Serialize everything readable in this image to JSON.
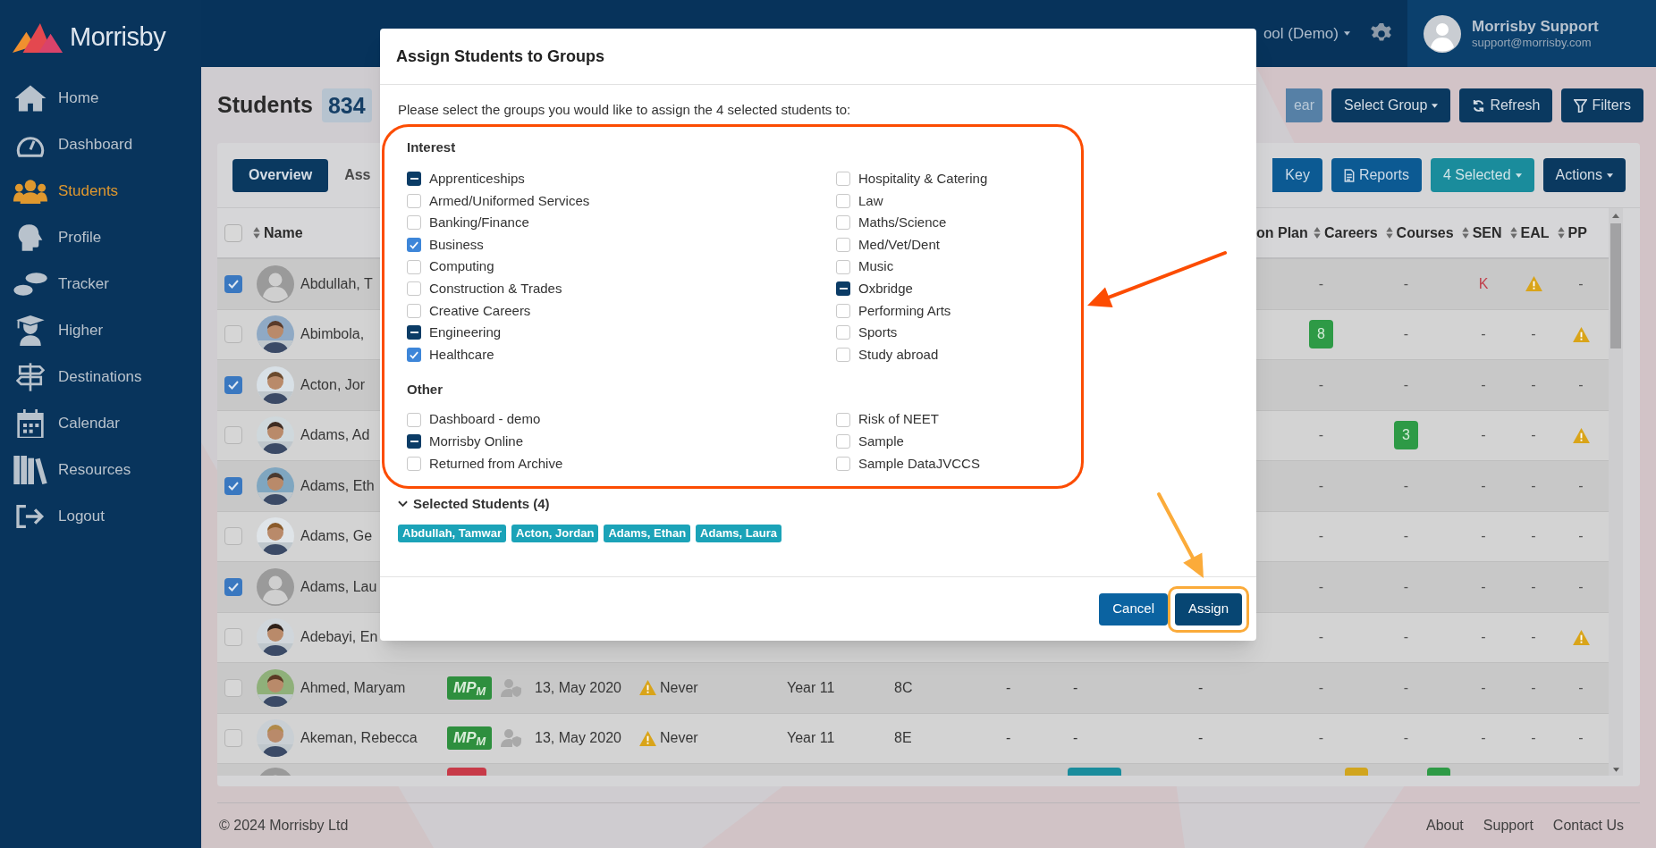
{
  "sidebar": {
    "logo": "Morrisby",
    "items": [
      {
        "label": "Home",
        "selected": false
      },
      {
        "label": "Dashboard",
        "selected": false
      },
      {
        "label": "Students",
        "selected": true
      },
      {
        "label": "Profile",
        "selected": false
      },
      {
        "label": "Tracker",
        "selected": false
      },
      {
        "label": "Higher",
        "selected": false
      },
      {
        "label": "Destinations",
        "selected": false
      },
      {
        "label": "Calendar",
        "selected": false
      },
      {
        "label": "Resources",
        "selected": false
      },
      {
        "label": "Logout",
        "selected": false
      }
    ]
  },
  "topbar": {
    "school": "ool (Demo)",
    "user": {
      "name": "Morrisby Support",
      "email": "support@morrisby.com"
    }
  },
  "page": {
    "title": "Students",
    "count": "834",
    "toolbar": [
      {
        "label": "ear",
        "disabled": true,
        "dropdown": false
      },
      {
        "label": "Select Group",
        "disabled": false,
        "dropdown": true
      },
      {
        "label": "Refresh",
        "disabled": false,
        "dropdown": false
      },
      {
        "label": "Filters",
        "disabled": false,
        "dropdown": false
      }
    ]
  },
  "tabs": [
    {
      "label": "Overview",
      "selected": true
    },
    {
      "label": "Ass",
      "selected": false
    }
  ],
  "table_actions": [
    {
      "label": "Key",
      "kind": "secondary",
      "dropdown": false
    },
    {
      "label": "Reports",
      "kind": "secondary",
      "dropdown": false
    },
    {
      "label": "4 Selected",
      "kind": "selection",
      "dropdown": true
    },
    {
      "label": "Actions",
      "kind": "primary",
      "dropdown": true
    }
  ],
  "table": {
    "select_all": {
      "checked": false
    },
    "columns": [
      {
        "label": "Name"
      },
      {
        "label": "on Plan"
      },
      {
        "label": "Careers"
      },
      {
        "label": "Courses"
      },
      {
        "label": "SEN"
      },
      {
        "label": "EAL"
      },
      {
        "label": "PP"
      }
    ],
    "rows": [
      {
        "kind": "student",
        "name": "Abdullah, T",
        "selected": true,
        "photo": false,
        "cells": [
          {
            "kind": "dash",
            "text": "-"
          },
          {
            "kind": "dash",
            "text": "-"
          },
          {
            "kind": "flag",
            "text": "K"
          },
          {
            "kind": "warning"
          },
          {
            "kind": "dash",
            "text": "-"
          }
        ]
      },
      {
        "kind": "student",
        "name": "Abimbola,",
        "selected": false,
        "photo": true,
        "cells": [
          {
            "kind": "count",
            "text": "8"
          },
          {
            "kind": "dash",
            "text": "-"
          },
          {
            "kind": "dash",
            "text": "-"
          },
          {
            "kind": "dash",
            "text": "-"
          },
          {
            "kind": "warning"
          }
        ]
      },
      {
        "kind": "student",
        "name": "Acton, Jor",
        "selected": true,
        "photo": true,
        "cells": [
          {
            "kind": "dash",
            "text": "-"
          },
          {
            "kind": "dash",
            "text": "-"
          },
          {
            "kind": "dash",
            "text": "-"
          },
          {
            "kind": "dash",
            "text": "-"
          },
          {
            "kind": "dash",
            "text": "-"
          }
        ]
      },
      {
        "kind": "student",
        "name": "Adams, Ad",
        "selected": false,
        "photo": true,
        "cells": [
          {
            "kind": "dash",
            "text": "-"
          },
          {
            "kind": "count",
            "text": "3"
          },
          {
            "kind": "dash",
            "text": "-"
          },
          {
            "kind": "dash",
            "text": "-"
          },
          {
            "kind": "warning"
          }
        ]
      },
      {
        "kind": "student",
        "name": "Adams, Eth",
        "selected": true,
        "photo": true,
        "cells": [
          {
            "kind": "dash",
            "text": "-"
          },
          {
            "kind": "dash",
            "text": "-"
          },
          {
            "kind": "dash",
            "text": "-"
          },
          {
            "kind": "dash",
            "text": "-"
          },
          {
            "kind": "dash",
            "text": "-"
          }
        ]
      },
      {
        "kind": "student",
        "name": "Adams, Ge",
        "selected": false,
        "photo": true,
        "cells": [
          {
            "kind": "dash",
            "text": "-"
          },
          {
            "kind": "dash",
            "text": "-"
          },
          {
            "kind": "dash",
            "text": "-"
          },
          {
            "kind": "dash",
            "text": "-"
          },
          {
            "kind": "dash",
            "text": "-"
          }
        ]
      },
      {
        "kind": "student",
        "name": "Adams, Lau",
        "selected": true,
        "photo": false,
        "cells": [
          {
            "kind": "dash",
            "text": "-"
          },
          {
            "kind": "dash",
            "text": "-"
          },
          {
            "kind": "dash",
            "text": "-"
          },
          {
            "kind": "dash",
            "text": "-"
          },
          {
            "kind": "dash",
            "text": "-"
          }
        ]
      },
      {
        "kind": "student",
        "name": "Adebayi, En",
        "selected": false,
        "photo": true,
        "cells": [
          {
            "kind": "dash",
            "text": "-"
          },
          {
            "kind": "dash",
            "text": "-"
          },
          {
            "kind": "dash",
            "text": "-"
          },
          {
            "kind": "dash",
            "text": "-"
          },
          {
            "kind": "warning"
          }
        ]
      },
      {
        "kind": "student",
        "name": "Ahmed, Maryam",
        "selected": false,
        "photo": true,
        "details": {
          "badge": "MP$_{M}$",
          "date": "13, May 2020",
          "login": "Never",
          "year": "Year 11",
          "form": "8C",
          "extra": [
            "-",
            "-",
            "-"
          ]
        },
        "cells": [
          {
            "kind": "dash",
            "text": "-"
          },
          {
            "kind": "dash",
            "text": "-"
          },
          {
            "kind": "dash",
            "text": "-"
          },
          {
            "kind": "dash",
            "text": "-"
          },
          {
            "kind": "dash",
            "text": "-"
          }
        ]
      },
      {
        "kind": "student",
        "name": "Akeman, Rebecca",
        "selected": false,
        "photo": true,
        "details": {
          "badge": "MP$_{M}$",
          "date": "13, May 2020",
          "login": "Never",
          "year": "Year 11",
          "form": "8E",
          "extra": [
            "-",
            "-",
            "-"
          ]
        },
        "cells": [
          {
            "kind": "dash",
            "text": "-"
          },
          {
            "kind": "dash",
            "text": "-"
          },
          {
            "kind": "dash",
            "text": "-"
          },
          {
            "kind": "dash",
            "text": "-"
          },
          {
            "kind": "dash",
            "text": "-"
          }
        ]
      },
      {
        "kind": "cut"
      }
    ]
  },
  "footer": {
    "copyright": "© 2024 Morrisby Ltd",
    "links": [
      "About",
      "Support",
      "Contact Us"
    ]
  },
  "modal": {
    "title": "Assign Students to Groups",
    "prompt": "Please select the groups you would like to assign the 4 selected students to:",
    "highlight": {
      "color": "#fc4c02"
    },
    "groups": [
      {
        "heading": "Interest",
        "items": [
          {
            "label": "Apprenticeships",
            "checked": false,
            "indeterminate": true
          },
          {
            "label": "Armed/Uniformed Services",
            "checked": false,
            "indeterminate": false
          },
          {
            "label": "Banking/Finance",
            "checked": false,
            "indeterminate": false
          },
          {
            "label": "Business",
            "checked": true,
            "indeterminate": false
          },
          {
            "label": "Computing",
            "checked": false,
            "indeterminate": false
          },
          {
            "label": "Construction & Trades",
            "checked": false,
            "indeterminate": false
          },
          {
            "label": "Creative Careers",
            "checked": false,
            "indeterminate": false
          },
          {
            "label": "Engineering",
            "checked": false,
            "indeterminate": true
          },
          {
            "label": "Healthcare",
            "checked": true,
            "indeterminate": false
          },
          {
            "label": "Hospitality & Catering",
            "checked": false,
            "indeterminate": false
          },
          {
            "label": "Law",
            "checked": false,
            "indeterminate": false
          },
          {
            "label": "Maths/Science",
            "checked": false,
            "indeterminate": false
          },
          {
            "label": "Med/Vet/Dent",
            "checked": false,
            "indeterminate": false
          },
          {
            "label": "Music",
            "checked": false,
            "indeterminate": false
          },
          {
            "label": "Oxbridge",
            "checked": false,
            "indeterminate": true
          },
          {
            "label": "Performing Arts",
            "checked": false,
            "indeterminate": false
          },
          {
            "label": "Sports",
            "checked": false,
            "indeterminate": false
          },
          {
            "label": "Study abroad",
            "checked": false,
            "indeterminate": false
          }
        ]
      },
      {
        "heading": "Other",
        "items": [
          {
            "label": "Dashboard - demo",
            "checked": false,
            "indeterminate": false
          },
          {
            "label": "Morrisby Online",
            "checked": false,
            "indeterminate": true
          },
          {
            "label": "Returned from Archive",
            "checked": false,
            "indeterminate": false
          },
          {
            "label": "Risk of NEET",
            "checked": false,
            "indeterminate": false
          },
          {
            "label": "Sample",
            "checked": false,
            "indeterminate": false
          },
          {
            "label": "Sample DataJVCCS",
            "checked": false,
            "indeterminate": false
          }
        ]
      }
    ],
    "selected_students": {
      "label": "Selected Students (4)",
      "expanded": true,
      "tags": [
        "Abdullah, Tamwar",
        "Acton, Jordan",
        "Adams, Ethan",
        "Adams, Laura"
      ]
    },
    "buttons": [
      {
        "label": "Cancel",
        "kind": "secondary"
      },
      {
        "label": "Assign",
        "kind": "primary",
        "highlight": {
          "color": "#fbab3a"
        }
      }
    ]
  },
  "arrows": [
    {
      "color": "#fc4c02"
    },
    {
      "color": "#fbab3a"
    }
  ]
}
